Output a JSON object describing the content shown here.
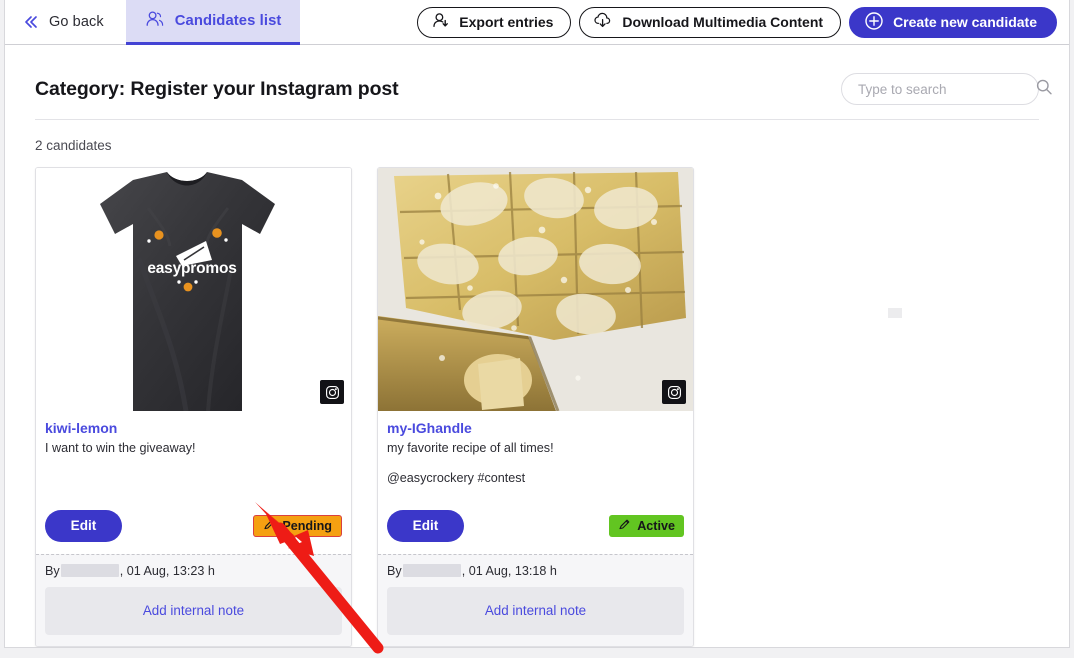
{
  "topbar": {
    "go_back_label": "Go back",
    "go_back_icon": "chevron-double-left-icon",
    "tab_label": "Candidates list",
    "tab_icon": "candidates-icon",
    "actions": [
      {
        "label": "Export entries",
        "icon": "export-user-icon",
        "style": "outline"
      },
      {
        "label": "Download Multimedia Content",
        "icon": "cloud-download-icon",
        "style": "outline"
      },
      {
        "label": "Create new candidate",
        "icon": "plus-circle-icon",
        "style": "primary"
      }
    ]
  },
  "header": {
    "title": "Category: Register your Instagram post",
    "search_placeholder": "Type to search",
    "search_value": "",
    "search_icon": "search-icon",
    "count_label": "2 candidates"
  },
  "cards": [
    {
      "handle": "kiwi-lemon",
      "description": "I want to win the giveaway!",
      "description2": "",
      "media_type": "tshirt-photo",
      "media_alt": "Dark grey t-shirt with easypromos logo",
      "logo_text": "easypromos",
      "source_icon": "instagram-icon",
      "edit_label": "Edit",
      "status_label": "Pending",
      "status_icon": "pencil-icon",
      "status_kind": "pending",
      "byline_prefix": "By",
      "byline_suffix": ", 01 Aug, 13:23 h",
      "note_label": "Add internal note"
    },
    {
      "handle": "my-IGhandle",
      "description": "my favorite recipe of all times!",
      "description2": "@easycrockery #contest",
      "media_type": "pastry-photo",
      "media_alt": "Golden ravioli pastries dusted with powdered sugar",
      "logo_text": "",
      "source_icon": "instagram-icon",
      "edit_label": "Edit",
      "status_label": "Active",
      "status_icon": "pencil-icon",
      "status_kind": "active",
      "byline_prefix": "By",
      "byline_suffix": ", 01 Aug, 13:18 h",
      "note_label": "Add internal note"
    }
  ],
  "annotation": {
    "arrow_icon": "red-arrow-annotation",
    "color": "#ee1c16"
  },
  "colors": {
    "accent": "#4a4ade",
    "primary_button": "#3b37c9",
    "pending": "#f5a011",
    "active": "#62c521",
    "tab_bg": "#dcdcf5"
  }
}
